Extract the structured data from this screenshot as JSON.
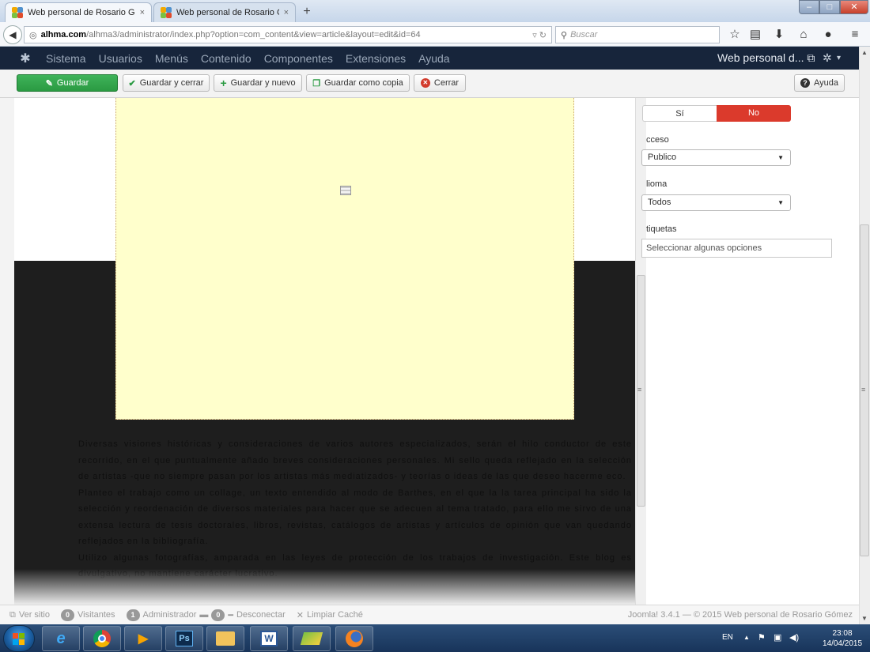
{
  "browser": {
    "tabs": [
      {
        "label": "Web personal de Rosario G...",
        "close": "×"
      },
      {
        "label": "Web personal de Rosario G...",
        "close": "×"
      }
    ],
    "new_tab": "+",
    "window_controls": {
      "minimize": "–",
      "maximize": "□",
      "close": "✕"
    },
    "url": {
      "host": "alhma.com",
      "path": "/alhma3/administrator/index.php?option=com_content&view=article&layout=edit&id=64"
    },
    "search_placeholder": "Buscar",
    "nav_icons": [
      "back-icon",
      "reload-icon",
      "search-icon",
      "star-icon",
      "bookmarks-icon",
      "download-icon",
      "home-icon",
      "chat-icon",
      "menu-icon"
    ]
  },
  "admin_menu": {
    "items": [
      "Sistema",
      "Usuarios",
      "Menús",
      "Contenido",
      "Componentes",
      "Extensiones",
      "Ayuda"
    ],
    "site_name": "Web personal d..."
  },
  "toolbar": {
    "save": "Guardar",
    "save_close": "Guardar y cerrar",
    "save_new": "Guardar y nuevo",
    "save_copy": "Guardar como copia",
    "close": "Cerrar",
    "help": "Ayuda"
  },
  "article": {
    "paragraphs": [
      "Diversas visiones históricas y consideraciones de varios autores especializados, serán el hilo conductor de este recorrido, en el que puntualmente añado breves consideraciones personales. Mi sello queda reflejado en la selección de artistas -que no siempre pasan por los artistas más mediatizados- y teorías o ideas de las que deseo hacerme eco.",
      "Planteo el trabajo como un collage, un texto entendido al modo de Barthes, en el que la la tarea principal ha sido la selección y reordenación de diversos materiales para hacer que se adecuen al tema tratado, para ello me sirvo de una extensa lectura de tesis doctorales, libros, revistas, catálogos de artistas y artículos de opinión que van quedando reflejados en la bibliografía.",
      "Utilizo algunas fotografías, amparada en las leyes de protección de los trabajos de investigación. Este blog es divulgativo, no mantiene carácter lucrativo."
    ]
  },
  "options": {
    "toggle_yes": "Sí",
    "toggle_no": "No",
    "access_label": "cceso",
    "access_value": "Publico",
    "language_label": "lioma",
    "language_value": "Todos",
    "tags_label": "tiquetas",
    "tags_placeholder": "Seleccionar algunas opciones"
  },
  "status_bar": {
    "view_site": "Ver sitio",
    "visitors_count": "0",
    "visitors_label": "Visitantes",
    "admins_count": "1",
    "admins_label": "Administrador",
    "messages_count": "0",
    "logout": "Desconectar",
    "clear_cache": "Limpiar Caché",
    "credit": "Joomla! 3.4.1 — © 2015 Web personal de Rosario Gómez"
  },
  "taskbar": {
    "language": "EN",
    "time": "23:08",
    "date": "14/04/2015"
  },
  "colors": {
    "admin_header": "#17253b",
    "save_green": "#2a9a42",
    "toggle_no_red": "#db3a2c",
    "placeholder_yellow": "#ffffcc"
  }
}
